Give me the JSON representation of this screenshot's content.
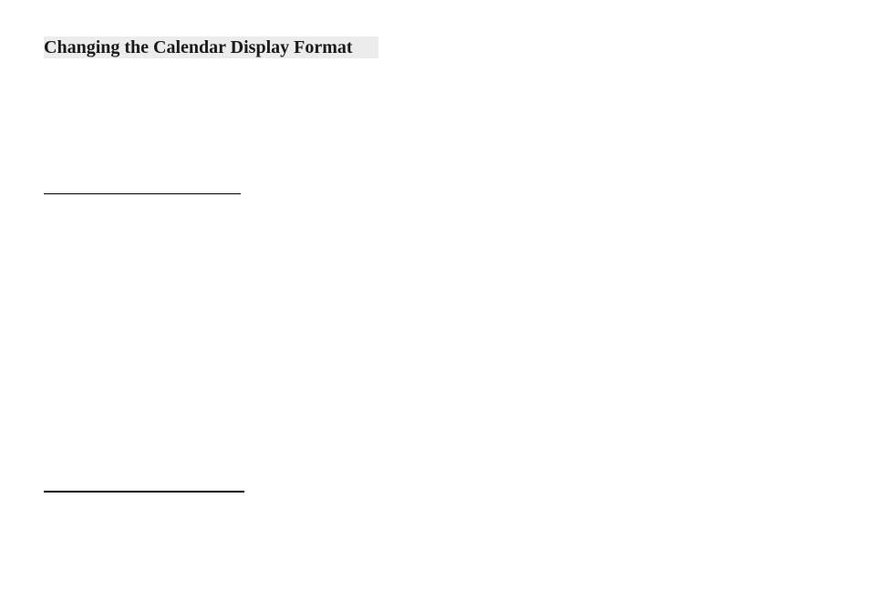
{
  "heading": {
    "title": "Changing the Calendar Display Format"
  }
}
